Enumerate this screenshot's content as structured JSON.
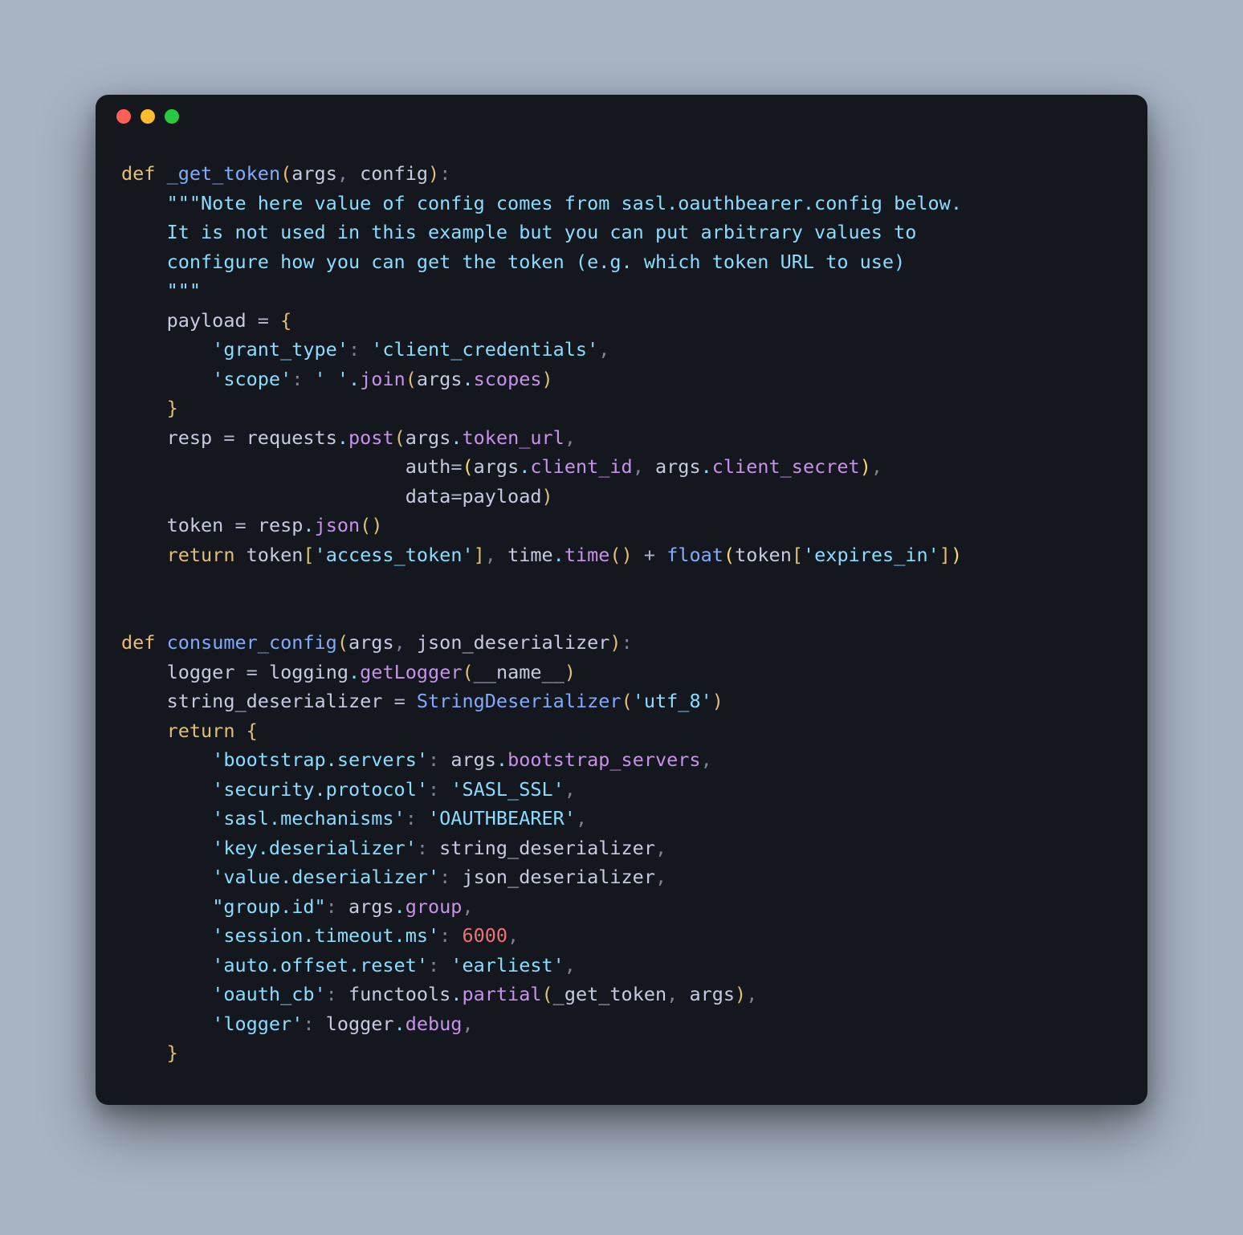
{
  "traffic_lights": [
    "red",
    "yellow",
    "green"
  ],
  "code": {
    "tokens": [
      {
        "cls": "tok-def",
        "t": "def"
      },
      {
        "cls": "tok-punc",
        "t": " "
      },
      {
        "cls": "tok-fn",
        "t": "_get_token"
      },
      {
        "cls": "tok-brace",
        "t": "("
      },
      {
        "cls": "tok-var",
        "t": "args"
      },
      {
        "cls": "tok-punc",
        "t": ", "
      },
      {
        "cls": "tok-var",
        "t": "config"
      },
      {
        "cls": "tok-brace",
        "t": ")"
      },
      {
        "cls": "tok-punc",
        "t": ":"
      },
      {
        "cls": "",
        "t": "\n"
      },
      {
        "cls": "",
        "t": "    "
      },
      {
        "cls": "tok-str",
        "t": "\"\"\"Note here value of config comes from sasl.oauthbearer.config below."
      },
      {
        "cls": "",
        "t": "\n"
      },
      {
        "cls": "",
        "t": "    "
      },
      {
        "cls": "tok-str",
        "t": "It is not used in this example but you can put arbitrary values to"
      },
      {
        "cls": "",
        "t": "\n"
      },
      {
        "cls": "",
        "t": "    "
      },
      {
        "cls": "tok-str",
        "t": "configure how you can get the token (e.g. which token URL to use)"
      },
      {
        "cls": "",
        "t": "\n"
      },
      {
        "cls": "",
        "t": "    "
      },
      {
        "cls": "tok-str",
        "t": "\"\"\""
      },
      {
        "cls": "",
        "t": "\n"
      },
      {
        "cls": "",
        "t": "    "
      },
      {
        "cls": "tok-var",
        "t": "payload"
      },
      {
        "cls": "tok-punc",
        "t": " "
      },
      {
        "cls": "tok-op",
        "t": "="
      },
      {
        "cls": "tok-punc",
        "t": " "
      },
      {
        "cls": "tok-brace",
        "t": "{"
      },
      {
        "cls": "",
        "t": "\n"
      },
      {
        "cls": "",
        "t": "        "
      },
      {
        "cls": "tok-str",
        "t": "'grant_type'"
      },
      {
        "cls": "tok-punc",
        "t": ": "
      },
      {
        "cls": "tok-str",
        "t": "'client_credentials'"
      },
      {
        "cls": "tok-punc",
        "t": ","
      },
      {
        "cls": "",
        "t": "\n"
      },
      {
        "cls": "",
        "t": "        "
      },
      {
        "cls": "tok-str",
        "t": "'scope'"
      },
      {
        "cls": "tok-punc",
        "t": ": "
      },
      {
        "cls": "tok-str",
        "t": "' '"
      },
      {
        "cls": "tok-dot",
        "t": "."
      },
      {
        "cls": "tok-attr",
        "t": "join"
      },
      {
        "cls": "tok-brace",
        "t": "("
      },
      {
        "cls": "tok-var",
        "t": "args"
      },
      {
        "cls": "tok-dot",
        "t": "."
      },
      {
        "cls": "tok-attr",
        "t": "scopes"
      },
      {
        "cls": "tok-brace",
        "t": ")"
      },
      {
        "cls": "",
        "t": "\n"
      },
      {
        "cls": "",
        "t": "    "
      },
      {
        "cls": "tok-brace",
        "t": "}"
      },
      {
        "cls": "",
        "t": "\n"
      },
      {
        "cls": "",
        "t": "    "
      },
      {
        "cls": "tok-var",
        "t": "resp"
      },
      {
        "cls": "tok-punc",
        "t": " "
      },
      {
        "cls": "tok-op",
        "t": "="
      },
      {
        "cls": "tok-punc",
        "t": " "
      },
      {
        "cls": "tok-var",
        "t": "requests"
      },
      {
        "cls": "tok-dot",
        "t": "."
      },
      {
        "cls": "tok-attr",
        "t": "post"
      },
      {
        "cls": "tok-brace",
        "t": "("
      },
      {
        "cls": "tok-var",
        "t": "args"
      },
      {
        "cls": "tok-dot",
        "t": "."
      },
      {
        "cls": "tok-attr",
        "t": "token_url"
      },
      {
        "cls": "tok-punc",
        "t": ","
      },
      {
        "cls": "",
        "t": "\n"
      },
      {
        "cls": "",
        "t": "                         "
      },
      {
        "cls": "tok-var",
        "t": "auth"
      },
      {
        "cls": "tok-op",
        "t": "="
      },
      {
        "cls": "tok-paren",
        "t": "("
      },
      {
        "cls": "tok-var",
        "t": "args"
      },
      {
        "cls": "tok-dot",
        "t": "."
      },
      {
        "cls": "tok-attr",
        "t": "client_id"
      },
      {
        "cls": "tok-punc",
        "t": ", "
      },
      {
        "cls": "tok-var",
        "t": "args"
      },
      {
        "cls": "tok-dot",
        "t": "."
      },
      {
        "cls": "tok-attr",
        "t": "client_secret"
      },
      {
        "cls": "tok-paren",
        "t": ")"
      },
      {
        "cls": "tok-punc",
        "t": ","
      },
      {
        "cls": "",
        "t": "\n"
      },
      {
        "cls": "",
        "t": "                         "
      },
      {
        "cls": "tok-var",
        "t": "data"
      },
      {
        "cls": "tok-op",
        "t": "="
      },
      {
        "cls": "tok-var",
        "t": "payload"
      },
      {
        "cls": "tok-brace",
        "t": ")"
      },
      {
        "cls": "",
        "t": "\n"
      },
      {
        "cls": "",
        "t": "    "
      },
      {
        "cls": "tok-var",
        "t": "token"
      },
      {
        "cls": "tok-punc",
        "t": " "
      },
      {
        "cls": "tok-op",
        "t": "="
      },
      {
        "cls": "tok-punc",
        "t": " "
      },
      {
        "cls": "tok-var",
        "t": "resp"
      },
      {
        "cls": "tok-dot",
        "t": "."
      },
      {
        "cls": "tok-attr",
        "t": "json"
      },
      {
        "cls": "tok-brace",
        "t": "("
      },
      {
        "cls": "tok-brace",
        "t": ")"
      },
      {
        "cls": "",
        "t": "\n"
      },
      {
        "cls": "",
        "t": "    "
      },
      {
        "cls": "tok-def",
        "t": "return"
      },
      {
        "cls": "tok-punc",
        "t": " "
      },
      {
        "cls": "tok-var",
        "t": "token"
      },
      {
        "cls": "tok-brace",
        "t": "["
      },
      {
        "cls": "tok-str",
        "t": "'access_token'"
      },
      {
        "cls": "tok-brace",
        "t": "]"
      },
      {
        "cls": "tok-punc",
        "t": ", "
      },
      {
        "cls": "tok-var",
        "t": "time"
      },
      {
        "cls": "tok-dot",
        "t": "."
      },
      {
        "cls": "tok-attr",
        "t": "time"
      },
      {
        "cls": "tok-brace",
        "t": "("
      },
      {
        "cls": "tok-brace",
        "t": ")"
      },
      {
        "cls": "tok-punc",
        "t": " "
      },
      {
        "cls": "tok-op",
        "t": "+"
      },
      {
        "cls": "tok-punc",
        "t": " "
      },
      {
        "cls": "tok-fn",
        "t": "float"
      },
      {
        "cls": "tok-paren",
        "t": "("
      },
      {
        "cls": "tok-var",
        "t": "token"
      },
      {
        "cls": "tok-brace",
        "t": "["
      },
      {
        "cls": "tok-str",
        "t": "'expires_in'"
      },
      {
        "cls": "tok-brace",
        "t": "]"
      },
      {
        "cls": "tok-paren",
        "t": ")"
      },
      {
        "cls": "",
        "t": "\n"
      },
      {
        "cls": "",
        "t": "\n"
      },
      {
        "cls": "",
        "t": "\n"
      },
      {
        "cls": "tok-def",
        "t": "def"
      },
      {
        "cls": "tok-punc",
        "t": " "
      },
      {
        "cls": "tok-fn",
        "t": "consumer_config"
      },
      {
        "cls": "tok-brace",
        "t": "("
      },
      {
        "cls": "tok-var",
        "t": "args"
      },
      {
        "cls": "tok-punc",
        "t": ", "
      },
      {
        "cls": "tok-var",
        "t": "json_deserializer"
      },
      {
        "cls": "tok-brace",
        "t": ")"
      },
      {
        "cls": "tok-punc",
        "t": ":"
      },
      {
        "cls": "",
        "t": "\n"
      },
      {
        "cls": "",
        "t": "    "
      },
      {
        "cls": "tok-var",
        "t": "logger"
      },
      {
        "cls": "tok-punc",
        "t": " "
      },
      {
        "cls": "tok-op",
        "t": "="
      },
      {
        "cls": "tok-punc",
        "t": " "
      },
      {
        "cls": "tok-var",
        "t": "logging"
      },
      {
        "cls": "tok-dot",
        "t": "."
      },
      {
        "cls": "tok-attr",
        "t": "getLogger"
      },
      {
        "cls": "tok-brace",
        "t": "("
      },
      {
        "cls": "tok-var",
        "t": "__name__"
      },
      {
        "cls": "tok-brace",
        "t": ")"
      },
      {
        "cls": "",
        "t": "\n"
      },
      {
        "cls": "",
        "t": "    "
      },
      {
        "cls": "tok-var",
        "t": "string_deserializer"
      },
      {
        "cls": "tok-punc",
        "t": " "
      },
      {
        "cls": "tok-op",
        "t": "="
      },
      {
        "cls": "tok-punc",
        "t": " "
      },
      {
        "cls": "tok-fn",
        "t": "StringDeserializer"
      },
      {
        "cls": "tok-brace",
        "t": "("
      },
      {
        "cls": "tok-str",
        "t": "'utf_8'"
      },
      {
        "cls": "tok-brace",
        "t": ")"
      },
      {
        "cls": "",
        "t": "\n"
      },
      {
        "cls": "",
        "t": "    "
      },
      {
        "cls": "tok-def",
        "t": "return"
      },
      {
        "cls": "tok-punc",
        "t": " "
      },
      {
        "cls": "tok-brace",
        "t": "{"
      },
      {
        "cls": "",
        "t": "\n"
      },
      {
        "cls": "",
        "t": "        "
      },
      {
        "cls": "tok-str",
        "t": "'bootstrap.servers'"
      },
      {
        "cls": "tok-punc",
        "t": ": "
      },
      {
        "cls": "tok-var",
        "t": "args"
      },
      {
        "cls": "tok-dot",
        "t": "."
      },
      {
        "cls": "tok-attr",
        "t": "bootstrap_servers"
      },
      {
        "cls": "tok-punc",
        "t": ","
      },
      {
        "cls": "",
        "t": "\n"
      },
      {
        "cls": "",
        "t": "        "
      },
      {
        "cls": "tok-str",
        "t": "'security.protocol'"
      },
      {
        "cls": "tok-punc",
        "t": ": "
      },
      {
        "cls": "tok-str",
        "t": "'SASL_SSL'"
      },
      {
        "cls": "tok-punc",
        "t": ","
      },
      {
        "cls": "",
        "t": "\n"
      },
      {
        "cls": "",
        "t": "        "
      },
      {
        "cls": "tok-str",
        "t": "'sasl.mechanisms'"
      },
      {
        "cls": "tok-punc",
        "t": ": "
      },
      {
        "cls": "tok-str",
        "t": "'OAUTHBEARER'"
      },
      {
        "cls": "tok-punc",
        "t": ","
      },
      {
        "cls": "",
        "t": "\n"
      },
      {
        "cls": "",
        "t": "        "
      },
      {
        "cls": "tok-str",
        "t": "'key.deserializer'"
      },
      {
        "cls": "tok-punc",
        "t": ": "
      },
      {
        "cls": "tok-var",
        "t": "string_deserializer"
      },
      {
        "cls": "tok-punc",
        "t": ","
      },
      {
        "cls": "",
        "t": "\n"
      },
      {
        "cls": "",
        "t": "        "
      },
      {
        "cls": "tok-str",
        "t": "'value.deserializer'"
      },
      {
        "cls": "tok-punc",
        "t": ": "
      },
      {
        "cls": "tok-var",
        "t": "json_deserializer"
      },
      {
        "cls": "tok-punc",
        "t": ","
      },
      {
        "cls": "",
        "t": "\n"
      },
      {
        "cls": "",
        "t": "        "
      },
      {
        "cls": "tok-str",
        "t": "\"group.id\""
      },
      {
        "cls": "tok-punc",
        "t": ": "
      },
      {
        "cls": "tok-var",
        "t": "args"
      },
      {
        "cls": "tok-dot",
        "t": "."
      },
      {
        "cls": "tok-attr",
        "t": "group"
      },
      {
        "cls": "tok-punc",
        "t": ","
      },
      {
        "cls": "",
        "t": "\n"
      },
      {
        "cls": "",
        "t": "        "
      },
      {
        "cls": "tok-str",
        "t": "'session.timeout.ms'"
      },
      {
        "cls": "tok-punc",
        "t": ": "
      },
      {
        "cls": "tok-num",
        "t": "6000"
      },
      {
        "cls": "tok-punc",
        "t": ","
      },
      {
        "cls": "",
        "t": "\n"
      },
      {
        "cls": "",
        "t": "        "
      },
      {
        "cls": "tok-str",
        "t": "'auto.offset.reset'"
      },
      {
        "cls": "tok-punc",
        "t": ": "
      },
      {
        "cls": "tok-str",
        "t": "'earliest'"
      },
      {
        "cls": "tok-punc",
        "t": ","
      },
      {
        "cls": "",
        "t": "\n"
      },
      {
        "cls": "",
        "t": "        "
      },
      {
        "cls": "tok-str",
        "t": "'oauth_cb'"
      },
      {
        "cls": "tok-punc",
        "t": ": "
      },
      {
        "cls": "tok-var",
        "t": "functools"
      },
      {
        "cls": "tok-dot",
        "t": "."
      },
      {
        "cls": "tok-attr",
        "t": "partial"
      },
      {
        "cls": "tok-brace",
        "t": "("
      },
      {
        "cls": "tok-var",
        "t": "_get_token"
      },
      {
        "cls": "tok-punc",
        "t": ", "
      },
      {
        "cls": "tok-var",
        "t": "args"
      },
      {
        "cls": "tok-brace",
        "t": ")"
      },
      {
        "cls": "tok-punc",
        "t": ","
      },
      {
        "cls": "",
        "t": "\n"
      },
      {
        "cls": "",
        "t": "        "
      },
      {
        "cls": "tok-str",
        "t": "'logger'"
      },
      {
        "cls": "tok-punc",
        "t": ": "
      },
      {
        "cls": "tok-var",
        "t": "logger"
      },
      {
        "cls": "tok-dot",
        "t": "."
      },
      {
        "cls": "tok-attr",
        "t": "debug"
      },
      {
        "cls": "tok-punc",
        "t": ","
      },
      {
        "cls": "",
        "t": "\n"
      },
      {
        "cls": "",
        "t": "    "
      },
      {
        "cls": "tok-brace",
        "t": "}"
      }
    ]
  }
}
